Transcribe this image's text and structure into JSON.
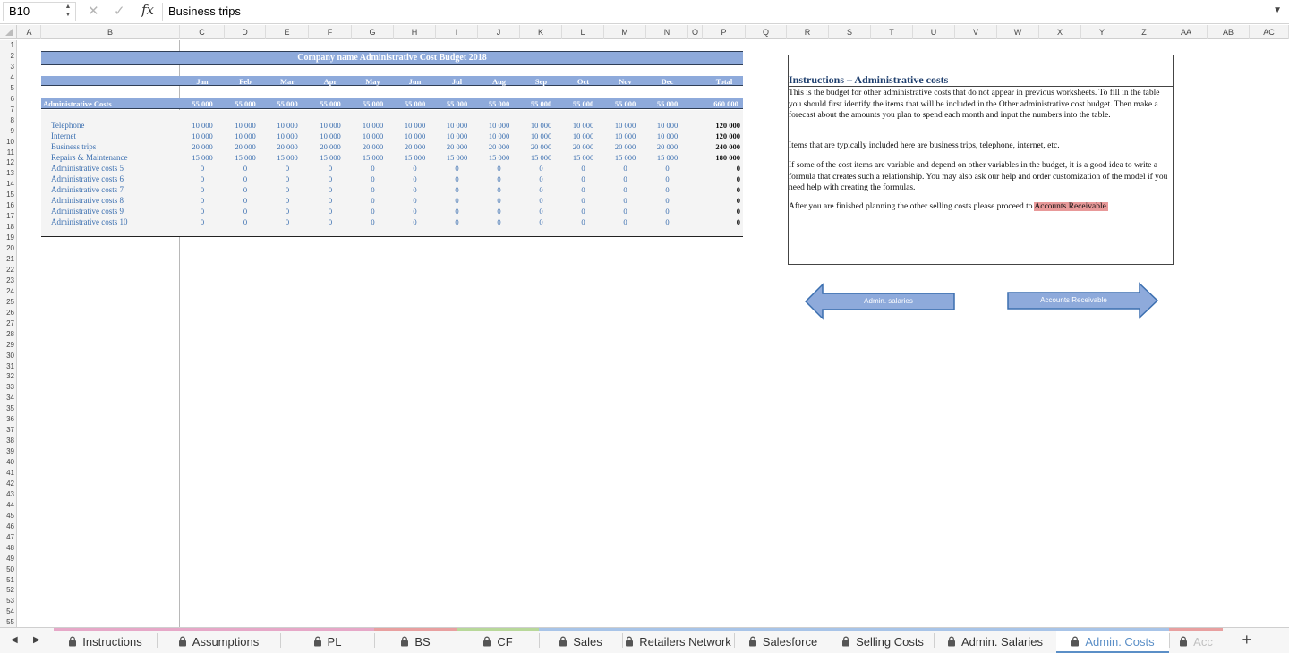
{
  "formula_bar": {
    "cell_ref": "B10",
    "value": "Business trips"
  },
  "columns": [
    "A",
    "B",
    "C",
    "D",
    "E",
    "F",
    "G",
    "H",
    "I",
    "J",
    "K",
    "L",
    "M",
    "N",
    "O",
    "P",
    "Q",
    "R",
    "S",
    "T",
    "U",
    "V",
    "W",
    "X",
    "Y",
    "Z",
    "AA",
    "AB",
    "AC"
  ],
  "rows_count": 54,
  "row_55_partial": "55",
  "table": {
    "title": "Company name Administrative Cost Budget 2018",
    "months": [
      "Jan",
      "Feb",
      "Mar",
      "Apr",
      "May",
      "Jun",
      "Jul",
      "Aug",
      "Sep",
      "Oct",
      "Nov",
      "Dec"
    ],
    "total_header": "Total",
    "summary_label": "Administrative Costs",
    "summary_values": [
      "55 000",
      "55 000",
      "55 000",
      "55 000",
      "55 000",
      "55 000",
      "55 000",
      "55 000",
      "55 000",
      "55 000",
      "55 000",
      "55 000"
    ],
    "summary_total": "660 000",
    "rows": [
      {
        "label": "Telephone",
        "values": [
          "10 000",
          "10 000",
          "10 000",
          "10 000",
          "10 000",
          "10 000",
          "10 000",
          "10 000",
          "10 000",
          "10 000",
          "10 000",
          "10 000"
        ],
        "total": "120 000"
      },
      {
        "label": "Internet",
        "values": [
          "10 000",
          "10 000",
          "10 000",
          "10 000",
          "10 000",
          "10 000",
          "10 000",
          "10 000",
          "10 000",
          "10 000",
          "10 000",
          "10 000"
        ],
        "total": "120 000"
      },
      {
        "label": "Business trips",
        "values": [
          "20 000",
          "20 000",
          "20 000",
          "20 000",
          "20 000",
          "20 000",
          "20 000",
          "20 000",
          "20 000",
          "20 000",
          "20 000",
          "20 000"
        ],
        "total": "240 000"
      },
      {
        "label": "Repairs & Maintenance",
        "values": [
          "15 000",
          "15 000",
          "15 000",
          "15 000",
          "15 000",
          "15 000",
          "15 000",
          "15 000",
          "15 000",
          "15 000",
          "15 000",
          "15 000"
        ],
        "total": "180 000"
      },
      {
        "label": "Administrative costs 5",
        "values": [
          "0",
          "0",
          "0",
          "0",
          "0",
          "0",
          "0",
          "0",
          "0",
          "0",
          "0",
          "0"
        ],
        "total": "0"
      },
      {
        "label": "Administrative costs 6",
        "values": [
          "0",
          "0",
          "0",
          "0",
          "0",
          "0",
          "0",
          "0",
          "0",
          "0",
          "0",
          "0"
        ],
        "total": "0"
      },
      {
        "label": "Administrative costs 7",
        "values": [
          "0",
          "0",
          "0",
          "0",
          "0",
          "0",
          "0",
          "0",
          "0",
          "0",
          "0",
          "0"
        ],
        "total": "0"
      },
      {
        "label": "Administrative costs 8",
        "values": [
          "0",
          "0",
          "0",
          "0",
          "0",
          "0",
          "0",
          "0",
          "0",
          "0",
          "0",
          "0"
        ],
        "total": "0"
      },
      {
        "label": "Administrative costs 9",
        "values": [
          "0",
          "0",
          "0",
          "0",
          "0",
          "0",
          "0",
          "0",
          "0",
          "0",
          "0",
          "0"
        ],
        "total": "0"
      },
      {
        "label": "Administrative costs 10",
        "values": [
          "0",
          "0",
          "0",
          "0",
          "0",
          "0",
          "0",
          "0",
          "0",
          "0",
          "0",
          "0"
        ],
        "total": "0"
      }
    ]
  },
  "instructions": {
    "title": "Instructions – Administrative costs",
    "p1": "This is the budget for other administrative costs that do not appear in previous worksheets. To fill in the table you should first identify the items that will be included in the Other administrative cost budget. Then make a forecast about the amounts you plan to spend each month and input the numbers into the table.",
    "p2": "Items that are typically included here are business trips, telephone, internet, etc.",
    "p3": "If some of the cost items are variable and depend on other variables in the budget, it is a good idea to write a formula that creates such a relationship. You may also ask our help and order customization of the model if you need help with creating the formulas.",
    "p4_prefix": "After you are finished planning the other selling costs please proceed to ",
    "p4_link": "Accounts Receivable."
  },
  "nav": {
    "back_label": "Admin. salaries",
    "forward_label": "Accounts Receivable",
    "color": "#8eaadb"
  },
  "tabs": [
    {
      "label": "Instructions",
      "color": "#e6a8c8"
    },
    {
      "label": "Assumptions",
      "color": "#e6a8c8"
    },
    {
      "label": "PL",
      "color": "#e6a8c8"
    },
    {
      "label": "BS",
      "color": "#e8a0a0"
    },
    {
      "label": "CF",
      "color": "#b8d89a"
    },
    {
      "label": "Sales",
      "color": "#a8c4e8"
    },
    {
      "label": "Retailers Network",
      "color": "#a8c4e8"
    },
    {
      "label": "Salesforce",
      "color": "#a8c4e8"
    },
    {
      "label": "Selling Costs",
      "color": "#a8c4e8"
    },
    {
      "label": "Admin. Salaries",
      "color": "#a8c4e8"
    },
    {
      "label": "Admin. Costs",
      "color": "#a8c4e8"
    },
    {
      "label": "Acc",
      "color": "#e8a0a0"
    }
  ],
  "active_tab": "Admin. Costs"
}
